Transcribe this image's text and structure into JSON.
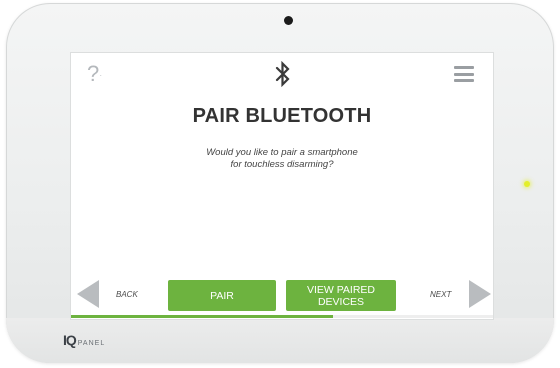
{
  "screen": {
    "help_label": "?",
    "title": "PAIR BLUETOOTH",
    "message_line1": "Would you like to pair a smartphone",
    "message_line2": "for touchless disarming?",
    "progress_fraction": 0.62
  },
  "nav": {
    "back_label": "BACK",
    "next_label": "NEXT"
  },
  "buttons": {
    "pair_label": "PAIR",
    "view_line1": "VIEW PAIRED",
    "view_line2": "DEVICES"
  },
  "device": {
    "logo_mark": "IQ",
    "logo_text": "PANEL"
  },
  "icons": {
    "help": "question-icon",
    "bluetooth": "bluetooth-icon",
    "menu": "hamburger-menu-icon",
    "back": "left-arrow-icon",
    "next": "right-arrow-icon"
  },
  "colors": {
    "accent_green": "#6db33f",
    "led_yellow": "#e3ef2a",
    "arrow_gray": "#b9bcbf"
  }
}
